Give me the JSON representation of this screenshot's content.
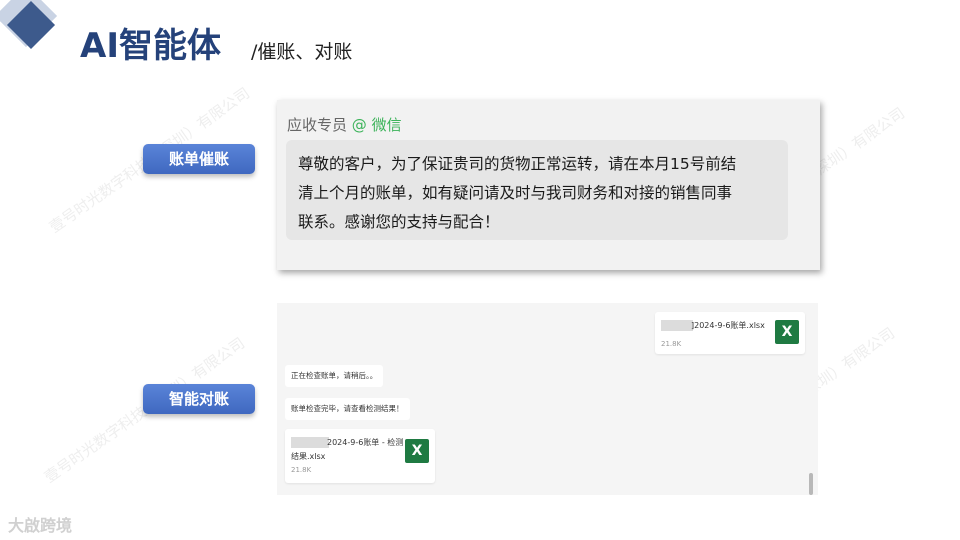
{
  "header": {
    "title": "AI智能体",
    "subtitle": "/催账、对账"
  },
  "watermark_text": "壹号时光数字科技（深圳）有限公司",
  "sections": {
    "billing_reminder": {
      "label": "账单催账"
    },
    "smart_reconcile": {
      "label": "智能对账"
    }
  },
  "reminder_panel": {
    "sender_name": "应收专员",
    "sender_channel": "@ 微信",
    "message_lines": [
      "尊敬的客户，为了保证贵司的货物正常运转，请在本月15号前结",
      "清上个月的账单，如有疑问请及时与我司财务和对接的销售同事",
      "联系。感谢您的支持与配合！"
    ]
  },
  "reconcile_panel": {
    "sent_file": {
      "name": "]2024-9-6账单.xlsx",
      "size": "21.8K",
      "icon": "X"
    },
    "bot_messages": [
      "正在检查账单，请稍后。。",
      "账单检查完毕，请查看检测结果！"
    ],
    "result_file": {
      "name_line1": "2024-9-6账单 - 检测",
      "name_line2": "结果.xlsx",
      "size": "21.8K",
      "icon": "X"
    }
  },
  "footer_logo": "大啟跨境",
  "colors": {
    "title": "#25427a",
    "pill": "#4a74cc",
    "wechat": "#3cb35a",
    "excel": "#1f7a42"
  }
}
